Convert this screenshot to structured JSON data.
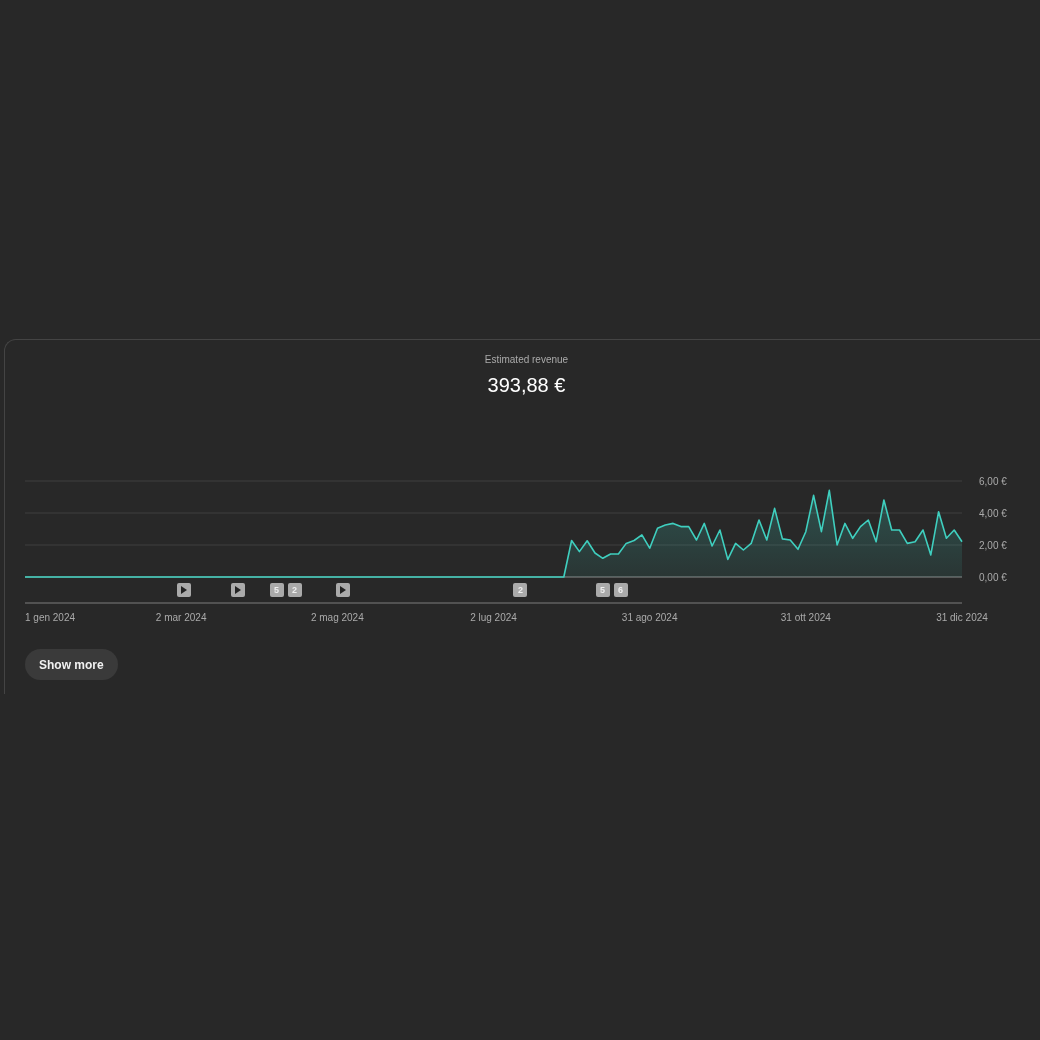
{
  "card": {
    "title": "Estimated revenue",
    "total": "393,88 €",
    "chart_data": {
      "type": "area",
      "ylim": [
        0,
        6
      ],
      "yticks": [
        {
          "value": 0,
          "label": "0,00 €"
        },
        {
          "value": 2,
          "label": "2,00 €"
        },
        {
          "value": 4,
          "label": "4,00 €"
        },
        {
          "value": 6,
          "label": "6,00 €"
        }
      ],
      "categories": [
        "1 gen 2024",
        null,
        null,
        null,
        null,
        null,
        null,
        null,
        null,
        null,
        null,
        null,
        null,
        null,
        null,
        null,
        null,
        null,
        null,
        null,
        "2 mar 2024",
        null,
        null,
        null,
        null,
        null,
        null,
        null,
        null,
        null,
        null,
        null,
        null,
        null,
        null,
        null,
        null,
        null,
        null,
        null,
        "2 mag 2024",
        null,
        null,
        null,
        null,
        null,
        null,
        null,
        null,
        null,
        null,
        null,
        null,
        null,
        null,
        null,
        null,
        null,
        null,
        null,
        "2 lug 2024",
        null,
        null,
        null,
        null,
        null,
        null,
        null,
        null,
        null,
        null,
        null,
        null,
        null,
        null,
        null,
        null,
        null,
        null,
        null,
        "31 ago 2024",
        null,
        null,
        null,
        null,
        null,
        null,
        null,
        null,
        null,
        null,
        null,
        null,
        null,
        null,
        null,
        null,
        null,
        null,
        null,
        "31 ott 2024",
        null,
        null,
        null,
        null,
        null,
        null,
        null,
        null,
        null,
        null,
        null,
        null,
        null,
        null,
        null,
        null,
        null,
        null,
        null,
        "31 dic 2024"
      ],
      "series": [
        {
          "color": "#3fcfbf",
          "values": [
            0,
            0,
            0,
            0,
            0,
            0,
            0,
            0,
            0,
            0,
            0,
            0,
            0,
            0,
            0,
            0,
            0,
            0,
            0,
            0,
            0,
            0,
            0,
            0,
            0,
            0,
            0,
            0,
            0,
            0,
            0,
            0,
            0,
            0,
            0,
            0,
            0,
            0,
            0,
            0,
            0,
            0,
            0,
            0,
            0,
            0,
            0,
            0,
            0,
            0,
            0,
            0,
            0,
            0,
            0,
            0,
            0,
            0,
            0,
            0,
            0,
            0,
            0,
            0,
            0,
            0,
            0,
            0,
            0,
            0,
            2.28,
            1.59,
            2.26,
            1.5,
            1.17,
            1.44,
            1.44,
            2.1,
            2.28,
            2.63,
            1.8,
            3.05,
            3.25,
            3.35,
            3.15,
            3.15,
            2.31,
            3.35,
            1.94,
            2.94,
            1.1,
            2.1,
            1.69,
            2.1,
            3.56,
            2.31,
            4.29,
            2.38,
            2.31,
            1.73,
            2.83,
            5.1,
            2.83,
            5.42,
            2.0,
            3.35,
            2.42,
            3.15,
            3.56,
            2.2,
            4.81,
            2.94,
            2.94,
            2.1,
            2.2,
            2.94,
            1.38,
            4.08,
            2.42,
            2.94,
            2.2
          ]
        }
      ]
    },
    "markers": [
      {
        "kind": "play"
      },
      {
        "kind": "play"
      },
      {
        "kind": "count",
        "label": "5"
      },
      {
        "kind": "count",
        "label": "2"
      },
      {
        "kind": "play"
      },
      {
        "kind": "count",
        "label": "2"
      },
      {
        "kind": "count",
        "label": "5"
      },
      {
        "kind": "count",
        "label": "6"
      }
    ],
    "button": "Show more"
  }
}
